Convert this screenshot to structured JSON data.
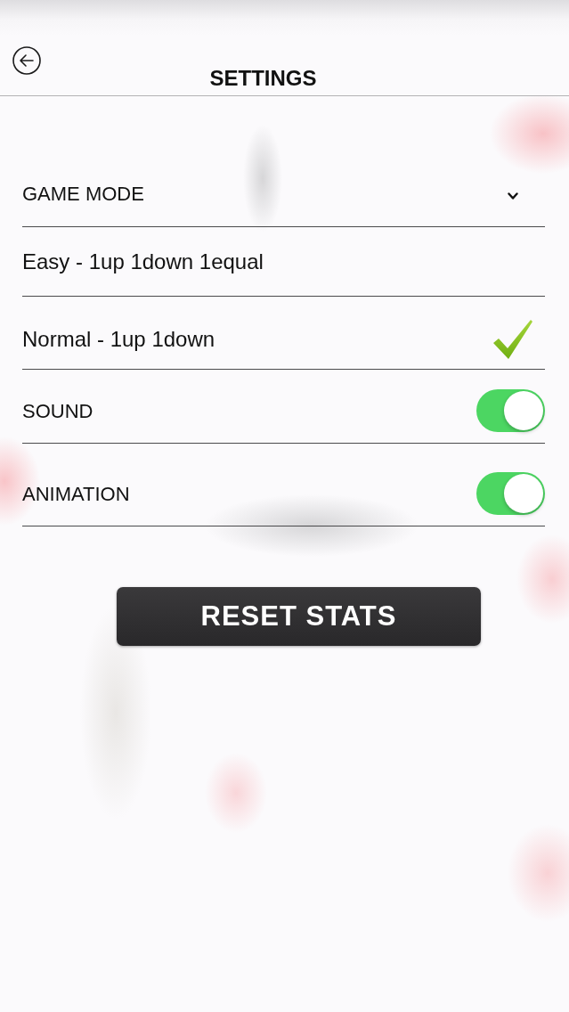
{
  "header": {
    "title": "SETTINGS"
  },
  "game_mode": {
    "label": "GAME MODE",
    "expanded": true,
    "options": [
      {
        "label": "Easy - 1up 1down 1equal",
        "selected": false
      },
      {
        "label": "Normal - 1up 1down",
        "selected": true
      }
    ]
  },
  "toggles": [
    {
      "label": "SOUND",
      "on": true
    },
    {
      "label": "ANIMATION",
      "on": true
    }
  ],
  "reset_button": {
    "label": "RESET STATS"
  }
}
